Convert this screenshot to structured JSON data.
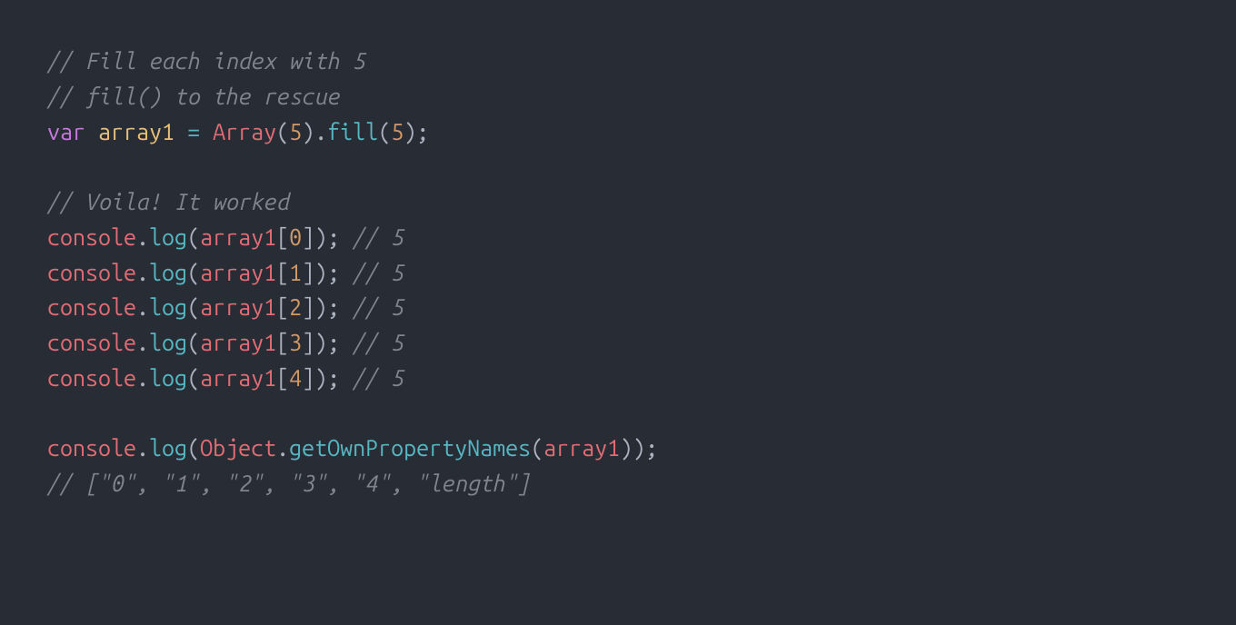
{
  "code": {
    "lines": [
      {
        "type": "comment",
        "text": "// Fill each index with 5"
      },
      {
        "type": "comment",
        "text": "// fill() to the rescue"
      },
      {
        "type": "decl",
        "keyword": "var",
        "ident": "array1",
        "eq": "=",
        "class": "Array",
        "open": "(",
        "arg1": "5",
        "close": ")",
        "dot": ".",
        "method": "fill",
        "open2": "(",
        "arg2": "5",
        "close2": ")",
        "semi": ";"
      },
      {
        "type": "blank",
        "text": ""
      },
      {
        "type": "comment",
        "text": "// Voila! It worked"
      },
      {
        "type": "log",
        "obj": "console",
        "dot": ".",
        "method": "log",
        "open": "(",
        "var": "array1",
        "bopen": "[",
        "idx": "0",
        "bclose": "]",
        "close": ")",
        "semi": ";",
        "trail": " // 5"
      },
      {
        "type": "log",
        "obj": "console",
        "dot": ".",
        "method": "log",
        "open": "(",
        "var": "array1",
        "bopen": "[",
        "idx": "1",
        "bclose": "]",
        "close": ")",
        "semi": ";",
        "trail": " // 5"
      },
      {
        "type": "log",
        "obj": "console",
        "dot": ".",
        "method": "log",
        "open": "(",
        "var": "array1",
        "bopen": "[",
        "idx": "2",
        "bclose": "]",
        "close": ")",
        "semi": ";",
        "trail": " // 5"
      },
      {
        "type": "log",
        "obj": "console",
        "dot": ".",
        "method": "log",
        "open": "(",
        "var": "array1",
        "bopen": "[",
        "idx": "3",
        "bclose": "]",
        "close": ")",
        "semi": ";",
        "trail": " // 5"
      },
      {
        "type": "log",
        "obj": "console",
        "dot": ".",
        "method": "log",
        "open": "(",
        "var": "array1",
        "bopen": "[",
        "idx": "4",
        "bclose": "]",
        "close": ")",
        "semi": ";",
        "trail": " // 5"
      },
      {
        "type": "blank",
        "text": ""
      },
      {
        "type": "log2",
        "obj": "console",
        "dot": ".",
        "method": "log",
        "open": "(",
        "class": "Object",
        "dot2": ".",
        "method2": "getOwnPropertyNames",
        "open2": "(",
        "var": "array1",
        "close2": ")",
        "close": ")",
        "semi": ";"
      },
      {
        "type": "comment",
        "text": "// [\"0\", \"1\", \"2\", \"3\", \"4\", \"length\"]"
      }
    ]
  }
}
